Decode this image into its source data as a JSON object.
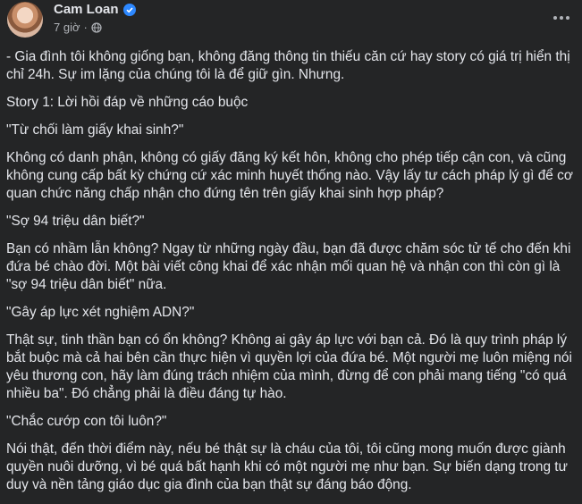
{
  "post": {
    "author": "Cam Loan",
    "time": "7 giờ",
    "separator": "·",
    "paragraphs": [
      "- Gia đình tôi không giống bạn, không đăng thông tin thiếu căn cứ hay story có giá trị hiển thị chỉ 24h. Sự im lặng của chúng tôi là để giữ gìn. Nhưng.",
      "Story 1: Lời hồi đáp về những cáo buộc",
      "\"Từ chối làm giấy khai sinh?\"",
      "Không có danh phận, không có giấy đăng ký kết hôn, không cho phép tiếp cận con, và cũng không cung cấp bất kỳ chứng cứ xác minh huyết thống nào. Vậy lấy tư cách pháp lý gì để cơ quan chức năng chấp nhận cho đứng tên trên giấy khai sinh hợp pháp?",
      "\"Sợ 94 triệu dân biết?\"",
      "Bạn có nhầm lẫn không? Ngay từ những ngày đầu, bạn đã được chăm sóc tử tế cho đến khi đứa bé chào đời. Một bài viết công khai để xác nhận mối quan hệ và nhận con thì còn gì là \"sợ 94 triệu dân biết\" nữa.",
      "\"Gây áp lực xét nghiệm ADN?\"",
      "Thật sự, tinh thần bạn có ổn không? Không ai gây áp lực với bạn cả. Đó là quy trình pháp lý bắt buộc mà cả hai bên cần thực hiện vì quyền lợi của đứa bé. Một người mẹ luôn miệng nói yêu thương con, hãy làm đúng trách nhiệm của mình, đừng để con phải mang tiếng \"có quá nhiều ba\". Đó chẳng phải là điều đáng tự hào.",
      "\"Chắc cướp con tôi luôn?\"",
      "Nói thật, đến thời điểm này, nếu bé thật sự là cháu của tôi, tôi cũng mong muốn được giành quyền nuôi dưỡng, vì bé quá bất hạnh khi có một người mẹ như bạn. Sự biến dạng trong tư duy và nền tảng giáo dục gia đình của bạn thật sự đáng báo động."
    ]
  },
  "icons": {
    "avatar": "avatar",
    "verified": "verified-badge-icon",
    "privacy": "globe-icon",
    "more": "more-options-icon"
  },
  "colors": {
    "background": "#242526",
    "text": "#e4e6eb",
    "secondary": "#b0b3b8",
    "verified": "#2d88ff"
  }
}
